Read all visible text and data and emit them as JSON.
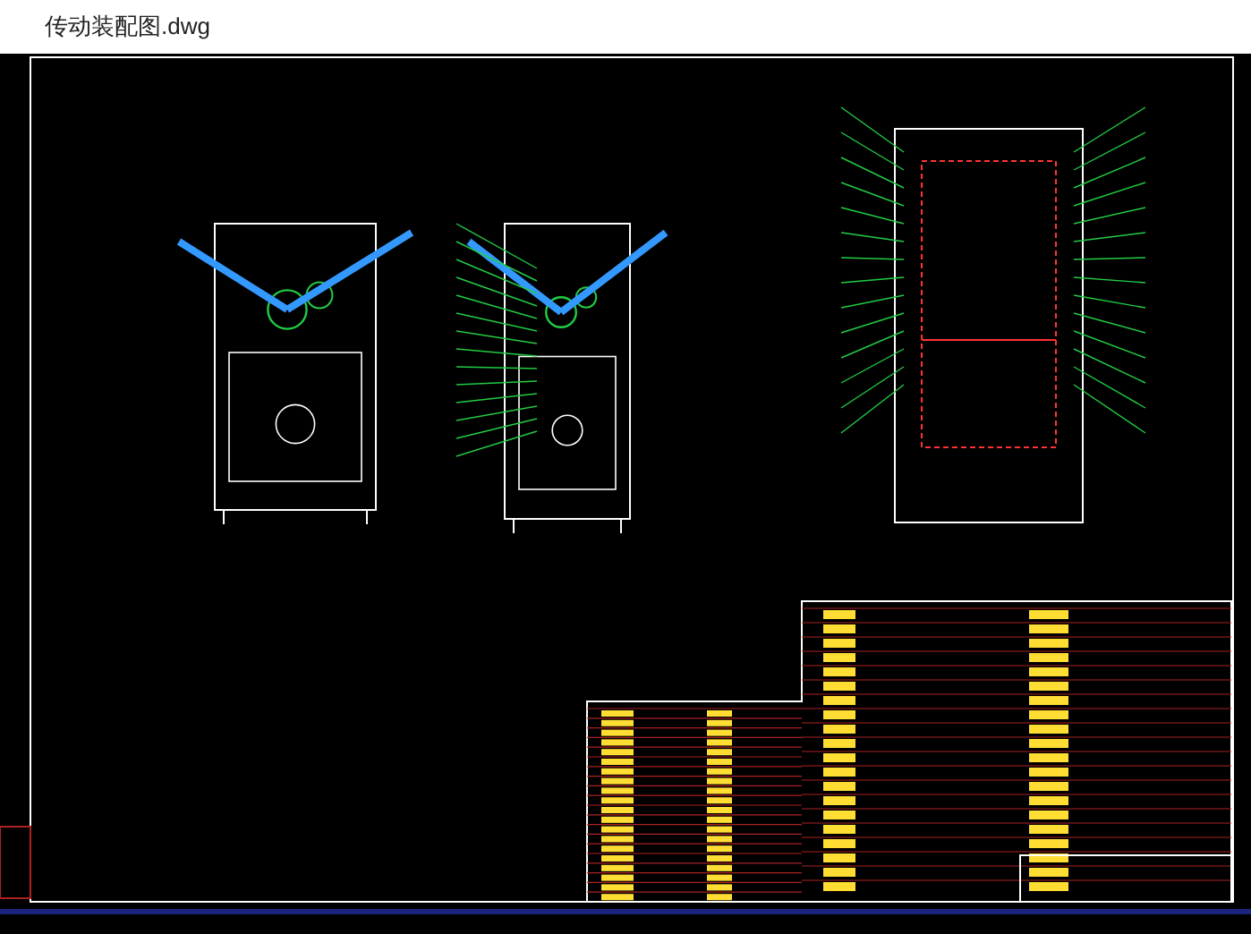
{
  "window": {
    "title": "传动装配图.dwg"
  }
}
